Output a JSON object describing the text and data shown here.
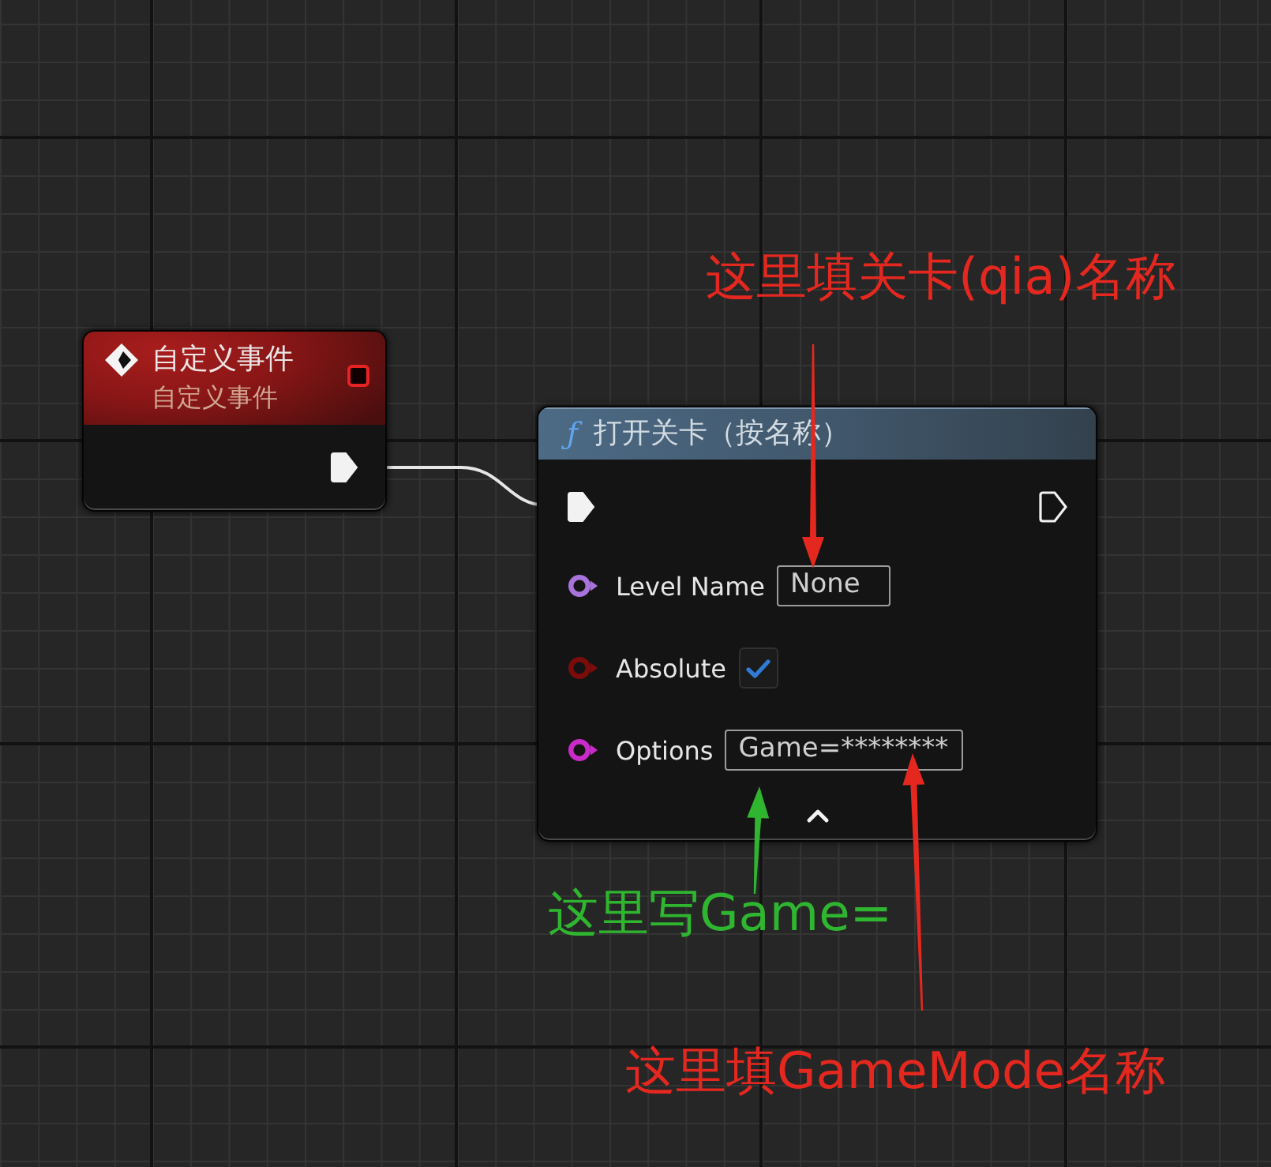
{
  "event_node": {
    "title": "自定义事件",
    "subtitle": "自定义事件",
    "exec_out": {
      "connected": true
    }
  },
  "function_node": {
    "symbol": "ƒ",
    "title": "打开关卡（按名称）",
    "exec_in": {
      "connected": true
    },
    "exec_out": {
      "connected": false
    },
    "pins": [
      {
        "kind": "field",
        "label": "Level Name",
        "color": "#a874dc",
        "value": "None"
      },
      {
        "kind": "checkbox",
        "label": "Absolute",
        "color": "#7c0c0c",
        "checked": true
      },
      {
        "kind": "field",
        "label": "Options",
        "color": "#c92bc9",
        "value": "Game=********"
      }
    ]
  },
  "annotations": [
    {
      "text": "这里填关卡(qia)名称",
      "color": "#e5281f"
    },
    {
      "text": "这里写Game=",
      "color": "#2fb52f"
    },
    {
      "text": "这里填GameMode名称",
      "color": "#e5281f"
    }
  ]
}
